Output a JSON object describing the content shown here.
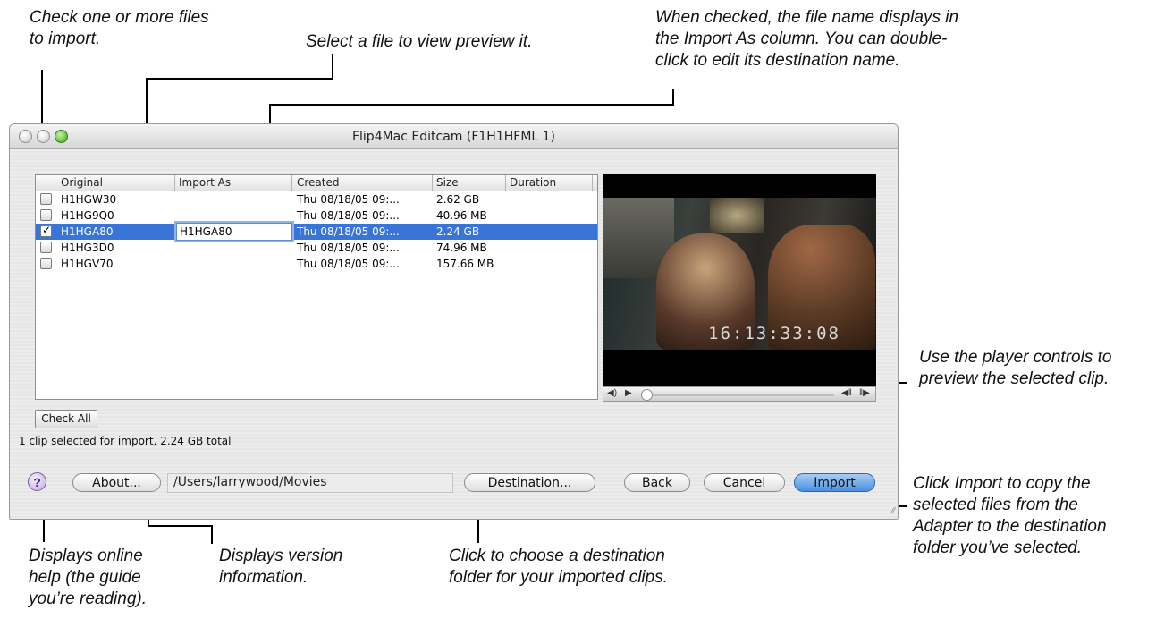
{
  "annotations": {
    "check_files": [
      "Check one or more files",
      "to import."
    ],
    "select_file": "Select a file to view preview it.",
    "when_checked": [
      "When checked, the file name displays in",
      "the Import As column. You can double-",
      "click to edit its destination name."
    ],
    "player_controls": [
      "Use the player controls to",
      "preview the selected clip."
    ],
    "import_note": [
      "Click Import to copy the",
      "selected files from the",
      "Adapter to the destination",
      "folder you’ve selected."
    ],
    "help_note": [
      "Displays online",
      "help (the guide",
      "you’re reading)."
    ],
    "about_note": [
      "Displays version",
      "information."
    ],
    "destination_note": [
      "Click to choose a destination",
      "folder for your imported clips."
    ]
  },
  "window": {
    "title": "Flip4Mac Editcam (F1H1HFML 1)"
  },
  "table": {
    "headers": {
      "original": "Original",
      "import_as": "Import As",
      "created": "Created",
      "size": "Size",
      "duration": "Duration"
    },
    "rows": [
      {
        "original": "H1HGW30",
        "import_as": "",
        "created": "Thu 08/18/05 09:...",
        "size": "2.62 GB",
        "duration": "",
        "checked": false,
        "selected": false
      },
      {
        "original": "H1HG9Q0",
        "import_as": "",
        "created": "Thu 08/18/05 09:...",
        "size": "40.96 MB",
        "duration": "",
        "checked": false,
        "selected": false
      },
      {
        "original": "H1HGA80",
        "import_as": "H1HGA80",
        "created": "Thu 08/18/05 09:...",
        "size": "2.24 GB",
        "duration": "",
        "checked": true,
        "selected": true
      },
      {
        "original": "H1HG3D0",
        "import_as": "",
        "created": "Thu 08/18/05 09:...",
        "size": "74.96 MB",
        "duration": "",
        "checked": false,
        "selected": false
      },
      {
        "original": "H1HGV70",
        "import_as": "",
        "created": "Thu 08/18/05 09:...",
        "size": "157.66 MB",
        "duration": "",
        "checked": false,
        "selected": false
      }
    ]
  },
  "preview": {
    "timecode": "16:13:33:08",
    "position_fraction": 0.0
  },
  "controls": {
    "check_all": "Check All",
    "status": "1 clip selected for import, 2.24 GB total",
    "help": "?",
    "about": "About...",
    "path": "/Users/larrywood/Movies",
    "destination": "Destination...",
    "back": "Back",
    "cancel": "Cancel",
    "import": "Import"
  },
  "colors": {
    "selection": "#3875d7",
    "import_button": "#4a8fe0",
    "zoom_button": "#36a51a"
  }
}
